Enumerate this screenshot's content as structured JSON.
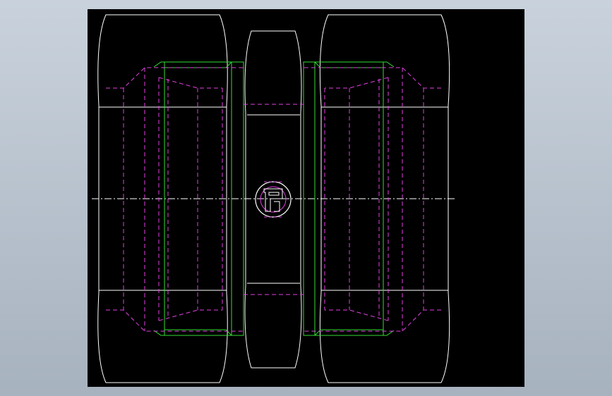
{
  "viewport": {
    "background_top": "#c9d2dc",
    "background_bottom": "#a7b2bf",
    "canvas_color": "#000000"
  },
  "colors": {
    "outline": "#ffffff",
    "hidden": "#e040e0",
    "thread": "#33dd33",
    "centerline": "#ffffff"
  },
  "drawing": {
    "label": ""
  }
}
